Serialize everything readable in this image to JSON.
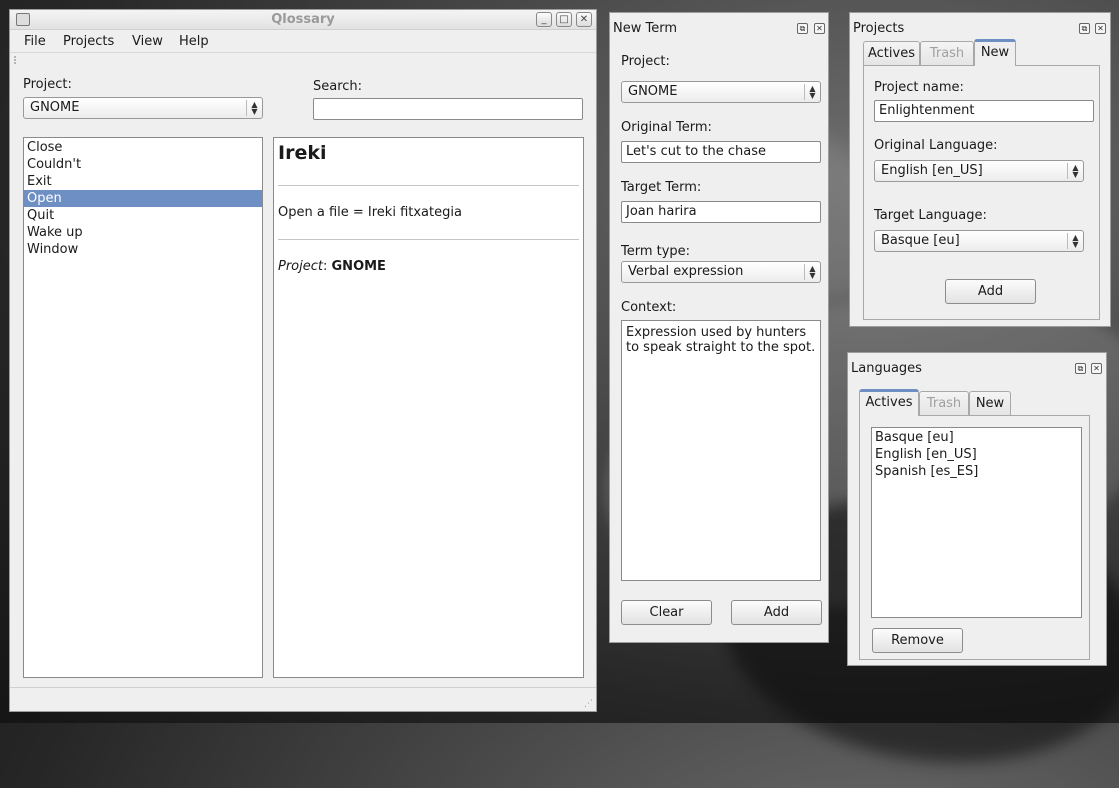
{
  "main_window": {
    "title": "Qlossary",
    "menu": [
      "File",
      "Projects",
      "View",
      "Help"
    ],
    "project_label": "Project:",
    "project_value": "GNOME",
    "search_label": "Search:",
    "search_value": "",
    "terms": [
      "Close",
      "Couldn't",
      "Exit",
      "Open",
      "Quit",
      "Wake up",
      "Window"
    ],
    "selected_term": "Open",
    "detail": {
      "heading": "Ireki",
      "translation_line": "Open a file = Ireki fitxategia",
      "project_key": "Project",
      "project_value": "GNOME"
    }
  },
  "new_term": {
    "title": "New Term",
    "project_label": "Project:",
    "project_value": "GNOME",
    "original_label": "Original Term:",
    "original_value": "Let's cut to the chase",
    "target_label": "Target Term:",
    "target_value": "Joan harira",
    "type_label": "Term type:",
    "type_value": "Verbal expression",
    "context_label": "Context:",
    "context_value": "Expression used by hunters\nto speak straight to the spot.",
    "clear_button": "Clear",
    "add_button": "Add"
  },
  "projects": {
    "title": "Projects",
    "tabs": [
      "Actives",
      "Trash",
      "New"
    ],
    "active_tab": "New",
    "name_label": "Project name:",
    "name_value": "Enlightenment",
    "original_lang_label": "Original Language:",
    "original_lang_value": "English [en_US]",
    "target_lang_label": "Target Language:",
    "target_lang_value": "Basque [eu]",
    "add_button": "Add"
  },
  "languages": {
    "title": "Languages",
    "tabs": [
      "Actives",
      "Trash",
      "New"
    ],
    "active_tab": "Actives",
    "items": [
      "Basque [eu]",
      "English [en_US]",
      "Spanish [es_ES]"
    ],
    "remove_button": "Remove"
  },
  "colors": {
    "selection": "#6d8fc4",
    "window_bg": "#efefef"
  }
}
